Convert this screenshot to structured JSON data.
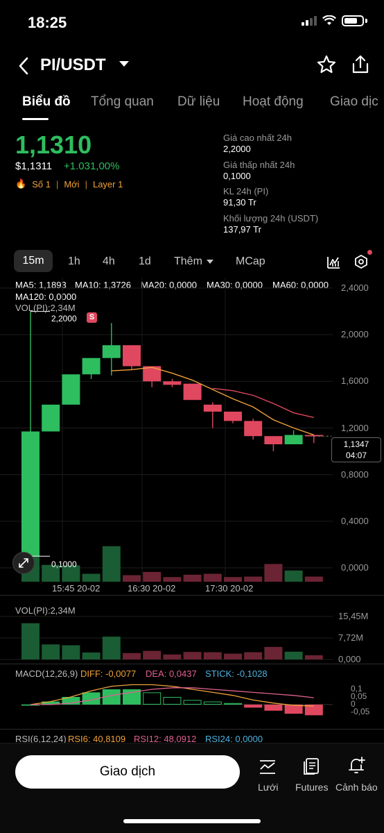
{
  "status": {
    "time": "18:25"
  },
  "header": {
    "pair": "PI/USDT"
  },
  "tabs": [
    {
      "label": "Biểu đồ",
      "active": true
    },
    {
      "label": "Tổng quan"
    },
    {
      "label": "Dữ liệu"
    },
    {
      "label": "Hoạt động"
    },
    {
      "label": "Giao dịc"
    }
  ],
  "ticker": {
    "last_price": "1,1310",
    "usd_price": "$1,1311",
    "change": "+1.031,00%",
    "tags": [
      "Số 1",
      "Mới",
      "Layer 1"
    ],
    "high_label": "Giá cao nhất 24h",
    "high_value": "2,2000",
    "low_label": "Giá thấp nhất 24h",
    "low_value": "0,1000",
    "vol_label": "KL 24h (PI)",
    "vol_value": "91,30 Tr",
    "turnover_label": "Khối lượng 24h (USDT)",
    "turnover_value": "137,97 Tr"
  },
  "periods": {
    "p15m": "15m",
    "p1h": "1h",
    "p4h": "4h",
    "p1d": "1d",
    "more": "Thêm",
    "mcap": "MCap"
  },
  "ma": {
    "ma5": "MA5: 1,1893",
    "ma10": "MA10: 1,3726",
    "ma20": "MA20: 0,0000",
    "ma30": "MA30: 0,0000",
    "ma60": "MA60: 0,0000",
    "ma120": "MA120: 0,0000",
    "vol": "VOL(PI):2,34M"
  },
  "colors": {
    "up": "#2ebd5f",
    "down": "#e0485f",
    "ma5": "#f0a23b",
    "ma10": "#e0485f",
    "ma20": "#4fb3e0",
    "ma30": "#e06060",
    "ma60": "#c070e0",
    "ma120": "#2ebd5f"
  },
  "price_chart": {
    "high_marker": "2,2000",
    "low_marker": "0,1000",
    "s_badge": "S",
    "current_price": "1,1347",
    "countdown": "04:07"
  },
  "chart_data": [
    {
      "type": "candlestick",
      "title": "",
      "y_ticks": [
        "2,4000",
        "2,0000",
        "1,6000",
        "1,2000",
        "0,8000",
        "0,4000",
        "0,0000"
      ],
      "x_ticks": [
        "15:45 20-02",
        "16:30 20-02",
        "17:30 20-02"
      ],
      "ylim": [
        0,
        2.4
      ],
      "candles": [
        {
          "o": 0.1,
          "h": 2.2,
          "l": 0.1,
          "c": 1.17
        },
        {
          "o": 1.17,
          "h": 1.4,
          "l": 1.17,
          "c": 1.4
        },
        {
          "o": 1.4,
          "h": 1.66,
          "l": 1.4,
          "c": 1.66
        },
        {
          "o": 1.66,
          "h": 1.8,
          "l": 1.62,
          "c": 1.8
        },
        {
          "o": 1.8,
          "h": 2.1,
          "l": 1.65,
          "c": 1.91
        },
        {
          "o": 1.91,
          "h": 1.91,
          "l": 1.7,
          "c": 1.73
        },
        {
          "o": 1.73,
          "h": 1.73,
          "l": 1.55,
          "c": 1.6
        },
        {
          "o": 1.6,
          "h": 1.62,
          "l": 1.55,
          "c": 1.57
        },
        {
          "o": 1.58,
          "h": 1.58,
          "l": 1.44,
          "c": 1.44
        },
        {
          "o": 1.4,
          "h": 1.42,
          "l": 1.2,
          "c": 1.34
        },
        {
          "o": 1.34,
          "h": 1.34,
          "l": 1.24,
          "c": 1.26
        },
        {
          "o": 1.26,
          "h": 1.28,
          "l": 1.1,
          "c": 1.13
        },
        {
          "o": 1.13,
          "h": 1.13,
          "l": 1.0,
          "c": 1.06
        },
        {
          "o": 1.06,
          "h": 1.18,
          "l": 1.06,
          "c": 1.14
        },
        {
          "o": 1.14,
          "h": 1.14,
          "l": 1.07,
          "c": 1.13
        }
      ],
      "ma5": [
        null,
        null,
        null,
        null,
        1.69,
        1.7,
        1.72,
        1.67,
        1.61,
        1.53,
        1.45,
        1.38,
        1.27,
        1.2,
        1.14
      ],
      "ma10": [
        null,
        null,
        null,
        null,
        null,
        null,
        null,
        null,
        null,
        1.54,
        1.52,
        1.48,
        1.41,
        1.33,
        1.29
      ],
      "volume": [
        10.4,
        3.6,
        3.5,
        1.7,
        7.6,
        1.4,
        2.1,
        1.0,
        1.5,
        1.7,
        1.0,
        1.1,
        3.8,
        2.4,
        1.1
      ]
    },
    {
      "type": "bar",
      "title": "VOL(PI):2,34M",
      "y_ticks": [
        "15,45M",
        "7,72M",
        "0,000"
      ],
      "ylim": [
        0,
        15.45
      ],
      "values": [
        13.0,
        5.4,
        5.1,
        2.5,
        8.2,
        2.3,
        3.1,
        1.8,
        2.7,
        2.6,
        2.1,
        2.6,
        4.5,
        2.8,
        1.5
      ]
    },
    {
      "type": "bar",
      "title": "MACD(12,26,9)",
      "labels": [
        "DIFF: -0,0077",
        "DEA: 0,0437",
        "STICK: -0,1028"
      ],
      "y_ticks": [
        "0,1",
        "0,05",
        "0",
        "-0,05"
      ],
      "stick": [
        0.0,
        0.02,
        0.05,
        0.08,
        0.1,
        0.1,
        0.08,
        0.05,
        0.03,
        0.02,
        0.01,
        -0.02,
        -0.04,
        -0.06,
        -0.07
      ],
      "diff": [
        0.0,
        0.02,
        0.05,
        0.09,
        0.12,
        0.13,
        0.13,
        0.12,
        0.1,
        0.08,
        0.06,
        0.03,
        0.01,
        -0.005,
        -0.01
      ],
      "dea": [
        0.0,
        0.0,
        0.01,
        0.03,
        0.06,
        0.08,
        0.1,
        0.11,
        0.11,
        0.1,
        0.09,
        0.08,
        0.07,
        0.06,
        0.045
      ]
    }
  ],
  "rsi": {
    "label": "RSI(6,12,24)",
    "rsi6": "RSI6: 40,8109",
    "rsi12": "RSI12: 48,0912",
    "rsi24": "RSI24: 0,0000"
  },
  "bottom_nav": {
    "trade": "Giao dịch",
    "grid": "Lưới",
    "futures": "Futures",
    "alert": "Cảnh báo"
  }
}
